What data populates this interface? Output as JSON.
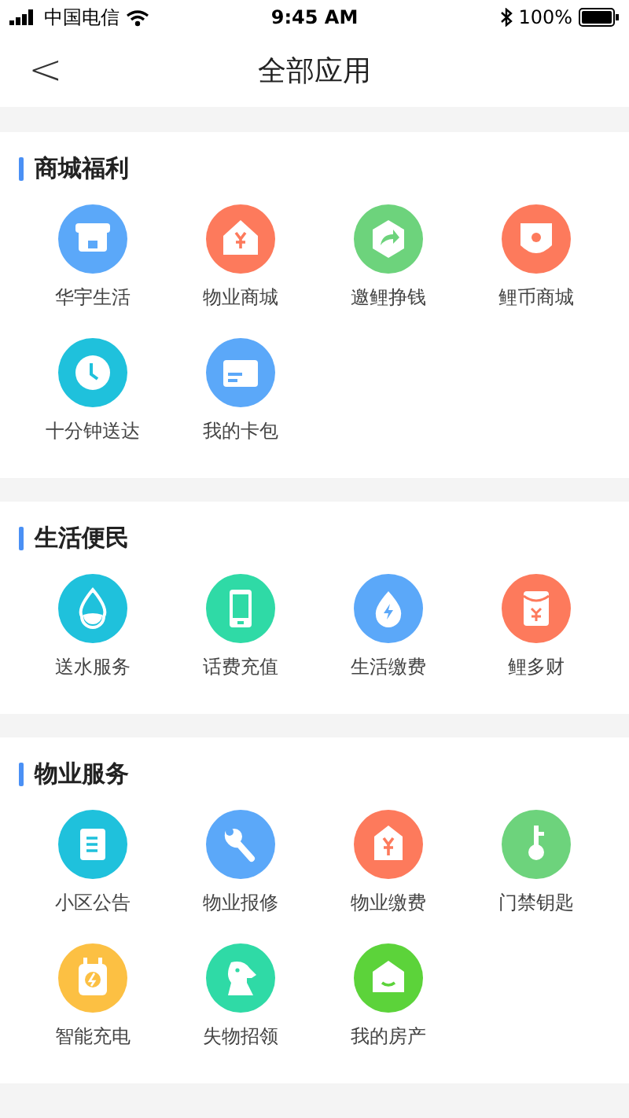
{
  "status_bar": {
    "carrier": "中国电信",
    "time": "9:45 AM",
    "battery": "100%"
  },
  "nav": {
    "back": "<",
    "title": "全部应用"
  },
  "sections": [
    {
      "title": "商城福利",
      "items": [
        {
          "label": "华宇生活",
          "kind": "shop",
          "color": "#5ba8f9"
        },
        {
          "label": "物业商城",
          "kind": "house",
          "color": "#fd7a5c"
        },
        {
          "label": "邀鲤挣钱",
          "kind": "share",
          "color": "#6dd37c"
        },
        {
          "label": "鲤币商城",
          "kind": "badge",
          "color": "#fd7a5c"
        },
        {
          "label": "十分钟送达",
          "kind": "clock",
          "color": "#1fc1dc"
        },
        {
          "label": "我的卡包",
          "kind": "card",
          "color": "#5ba8f9"
        }
      ]
    },
    {
      "title": "生活便民",
      "items": [
        {
          "label": "送水服务",
          "kind": "drop",
          "color": "#1fc1dc"
        },
        {
          "label": "话费充值",
          "kind": "phone",
          "color": "#2fdaa6"
        },
        {
          "label": "生活缴费",
          "kind": "bolt",
          "color": "#5ba8f9"
        },
        {
          "label": "鲤多财",
          "kind": "envelope",
          "color": "#fd7a5c"
        }
      ]
    },
    {
      "title": "物业服务",
      "items": [
        {
          "label": "小区公告",
          "kind": "notice",
          "color": "#1fc1dc"
        },
        {
          "label": "物业报修",
          "kind": "wrench",
          "color": "#5ba8f9"
        },
        {
          "label": "物业缴费",
          "kind": "bill",
          "color": "#fd7a5c"
        },
        {
          "label": "门禁钥匙",
          "kind": "key",
          "color": "#6dd37c"
        },
        {
          "label": "智能充电",
          "kind": "charger",
          "color": "#fcc043"
        },
        {
          "label": "失物招领",
          "kind": "dog",
          "color": "#2fdaa6"
        },
        {
          "label": "我的房产",
          "kind": "home",
          "color": "#5cd33a"
        }
      ]
    }
  ]
}
